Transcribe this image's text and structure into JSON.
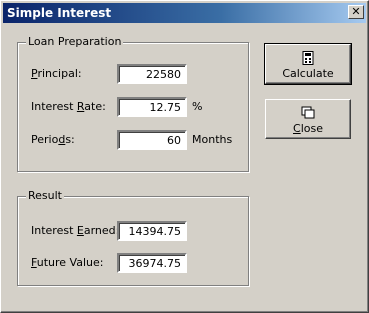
{
  "window": {
    "title": "Simple Interest",
    "close_symbol": "✕"
  },
  "loan": {
    "group_title": "Loan Preparation",
    "principal": {
      "label_u": "P",
      "label_rest": "rincipal:",
      "value": "22580"
    },
    "rate": {
      "label_pre": "Interest ",
      "label_u": "R",
      "label_rest": "ate:",
      "value": "12.75",
      "unit": "%"
    },
    "periods": {
      "label_pre": "Perio",
      "label_u": "d",
      "label_rest": "s:",
      "value": "60",
      "unit": "Months"
    }
  },
  "result": {
    "group_title": "Result",
    "interest": {
      "label_pre": "Interest ",
      "label_u": "E",
      "label_rest": "arned:",
      "value": "14394.75"
    },
    "future": {
      "label_u": "F",
      "label_rest": "uture Value:",
      "value": "36974.75"
    }
  },
  "buttons": {
    "calculate": {
      "label_u": "",
      "label_rest": "Calculate",
      "icon": "calculator-icon"
    },
    "close": {
      "label_u": "C",
      "label_rest": "lose",
      "icon": "close-windows-icon"
    }
  }
}
